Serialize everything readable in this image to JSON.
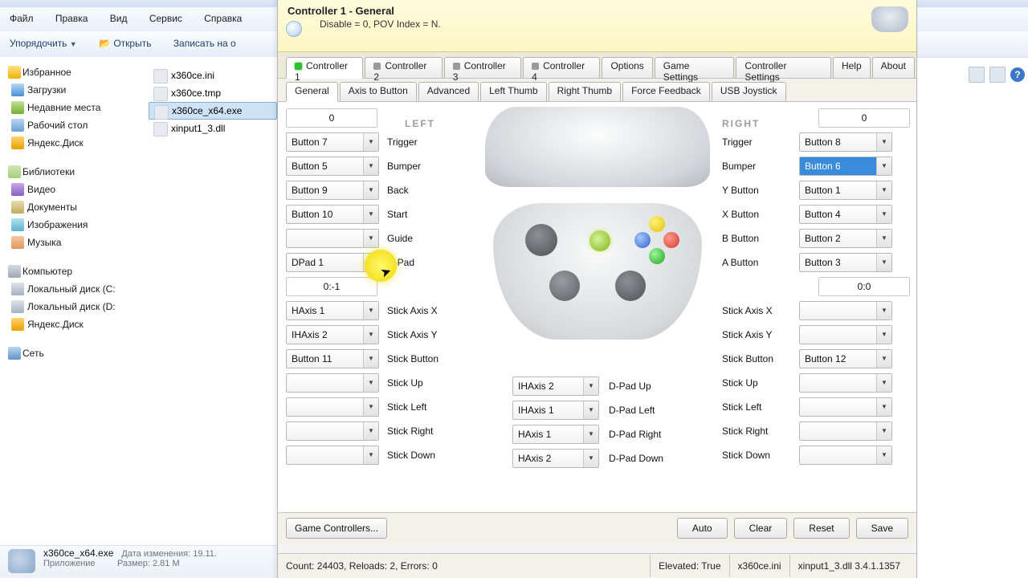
{
  "explorer": {
    "menu": [
      "Файл",
      "Правка",
      "Вид",
      "Сервис",
      "Справка"
    ],
    "toolbar": {
      "organize": "Упорядочить",
      "open": "Открыть",
      "save": "Записать на о"
    },
    "nav": {
      "fav_head": "Избранное",
      "fav": [
        "Загрузки",
        "Недавние места",
        "Рабочий стол",
        "Яндекс.Диск"
      ],
      "lib_head": "Библиотеки",
      "lib": [
        "Видео",
        "Документы",
        "Изображения",
        "Музыка"
      ],
      "comp_head": "Компьютер",
      "comp": [
        "Локальный диск (C:",
        "Локальный диск (D:",
        "Яндекс.Диск"
      ],
      "net_head": "Сеть"
    },
    "files": [
      "x360ce.ini",
      "x360ce.tmp",
      "x360ce_x64.exe",
      "xinput1_3.dll"
    ],
    "details": {
      "name": "x360ce_x64.exe",
      "type": "Приложение",
      "date_lbl": "Дата изменения:",
      "date": "19.11.",
      "size_lbl": "Размер:",
      "size": "2.81 М"
    }
  },
  "x360": {
    "header": {
      "title": "Controller 1 - General",
      "sub": "Disable = 0, POV Index = N."
    },
    "tabs1": [
      "Controller 1",
      "Controller 2",
      "Controller 3",
      "Controller 4",
      "Options",
      "Game Settings",
      "Controller Settings",
      "Help",
      "About"
    ],
    "tabs2": [
      "General",
      "Axis to Button",
      "Advanced",
      "Left Thumb",
      "Right Thumb",
      "Force Feedback",
      "USB Joystick"
    ],
    "indicators": {
      "left": "0",
      "left_dpad": "0:-1",
      "right": "0",
      "right_axis": "0:0"
    },
    "cols": {
      "left": "LEFT",
      "right": "RIGHT"
    },
    "left": [
      {
        "v": "Button 7",
        "l": "Trigger"
      },
      {
        "v": "Button 5",
        "l": "Bumper"
      },
      {
        "v": "Button 9",
        "l": "Back"
      },
      {
        "v": "Button 10",
        "l": "Start"
      },
      {
        "v": "",
        "l": "Guide"
      },
      {
        "v": "DPad 1",
        "l": "D-Pad"
      }
    ],
    "left2": [
      {
        "v": "HAxis 1",
        "l": "Stick Axis X"
      },
      {
        "v": "IHAxis 2",
        "l": "Stick Axis Y"
      },
      {
        "v": "Button 11",
        "l": "Stick Button"
      },
      {
        "v": "",
        "l": "Stick Up"
      },
      {
        "v": "",
        "l": "Stick Left"
      },
      {
        "v": "",
        "l": "Stick Right"
      },
      {
        "v": "",
        "l": "Stick Down"
      }
    ],
    "right": [
      {
        "v": "Button 8",
        "l": "Trigger"
      },
      {
        "v": "Button 6",
        "l": "Bumper"
      },
      {
        "v": "Button 1",
        "l": "Y Button"
      },
      {
        "v": "Button 4",
        "l": "X Button"
      },
      {
        "v": "Button 2",
        "l": "B Button"
      },
      {
        "v": "Button 3",
        "l": "A Button"
      }
    ],
    "right2": [
      {
        "v": "",
        "l": "Stick Axis X"
      },
      {
        "v": "",
        "l": "Stick Axis Y"
      },
      {
        "v": "Button 12",
        "l": "Stick Button"
      },
      {
        "v": "",
        "l": "Stick Up"
      },
      {
        "v": "",
        "l": "Stick Left"
      },
      {
        "v": "",
        "l": "Stick Right"
      },
      {
        "v": "",
        "l": "Stick Down"
      }
    ],
    "dpad": [
      {
        "v": "IHAxis 2",
        "l": "D-Pad Up"
      },
      {
        "v": "IHAxis 1",
        "l": "D-Pad Left"
      },
      {
        "v": "HAxis 1",
        "l": "D-Pad Right"
      },
      {
        "v": "HAxis 2",
        "l": "D-Pad Down"
      }
    ],
    "buttons": {
      "gc": "Game Controllers...",
      "auto": "Auto",
      "clear": "Clear",
      "reset": "Reset",
      "save": "Save"
    },
    "status": {
      "count": "Count: 24403, Reloads: 2, Errors: 0",
      "elev": "Elevated: True",
      "ini": "x360ce.ini",
      "dll": "xinput1_3.dll 3.4.1.1357"
    }
  }
}
